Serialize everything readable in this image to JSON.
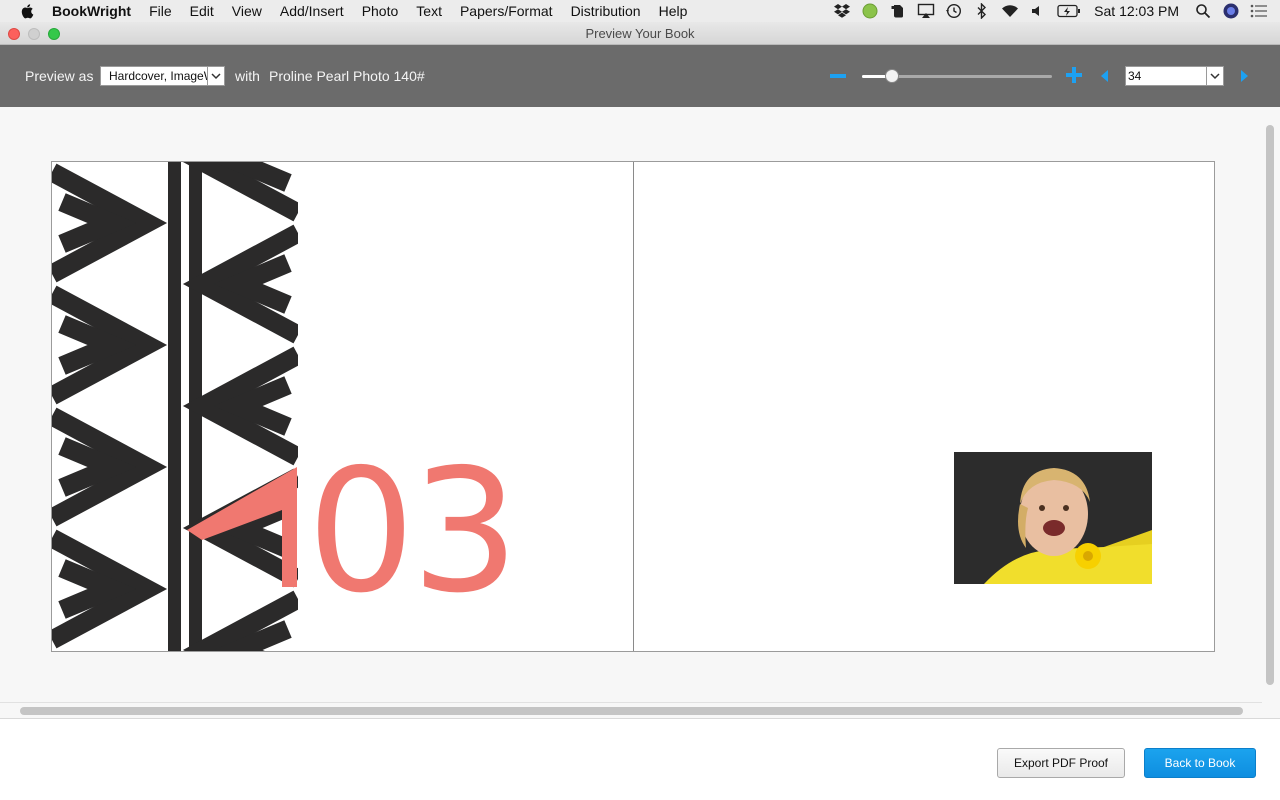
{
  "menubar": {
    "app_name": "BookWright",
    "items": [
      "File",
      "Edit",
      "View",
      "Add/Insert",
      "Photo",
      "Text",
      "Papers/Format",
      "Distribution",
      "Help"
    ],
    "clock": "Sat 12:03 PM"
  },
  "window": {
    "title": "Preview Your Book"
  },
  "toolbar": {
    "preview_as_label": "Preview as",
    "preview_format": "Hardcover, ImageWrap",
    "with_label": "with",
    "paper": "Proline Pearl Photo 140#",
    "zoom_level_fraction": 0.16,
    "page_number": "34"
  },
  "spread": {
    "chapter_number": "03",
    "accent_color": "#f07870",
    "pattern_color": "#2b2a2a"
  },
  "footer": {
    "export_label": "Export PDF Proof",
    "back_label": "Back to Book"
  },
  "colors": {
    "accent_blue": "#1da1f2",
    "toolbar_bg": "#6b6b6b"
  }
}
